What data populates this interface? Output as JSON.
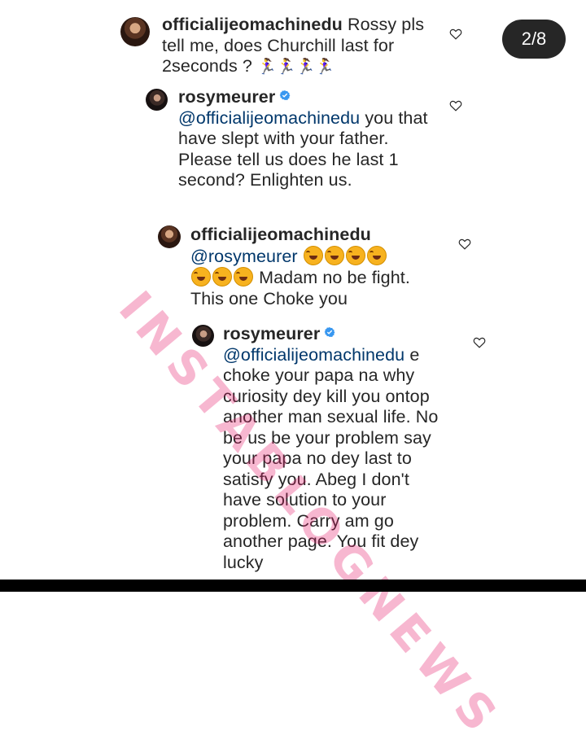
{
  "page": {
    "indicator": "2/8",
    "watermark": "INSTABLOGNEWS"
  },
  "comments": [
    {
      "username": "officialijeomachinedu",
      "text": "Rossy pls tell me, does Churchill last for 2seconds ?",
      "mention": "",
      "emoji": "🏃‍♀️🏃‍♀️🏃‍♀️🏃‍♀️"
    },
    {
      "username": "rosymeurer",
      "verified": true,
      "mention": "@officialijeomachinedu",
      "text": "you that have slept with your father. Please tell us does he last 1 second? Enlighten us."
    },
    {
      "username": "officialijeomachinedu",
      "mention": "@rosymeurer",
      "text": "Madam no be fight. This one Choke you",
      "emoji": "😂😂😂😂😂😂😂"
    },
    {
      "username": "rosymeurer",
      "verified": true,
      "mention": "@officialijeomachinedu",
      "text": "e choke your papa na why curiosity dey kill you ontop another man sexual life. No be us be your problem say your papa no dey last to satisfy you. Abeg I don't have solution to your problem. Carry am go another page. You fit dey lucky"
    }
  ],
  "icons": {
    "heart": "heart-icon",
    "verified": "verified-badge-icon",
    "avatar": "profile-avatar"
  },
  "colors": {
    "text": "#262626",
    "mention": "#00376b",
    "verified": "#3897f0",
    "indicator_bg": "#262626",
    "watermark": "#e61e6e"
  }
}
